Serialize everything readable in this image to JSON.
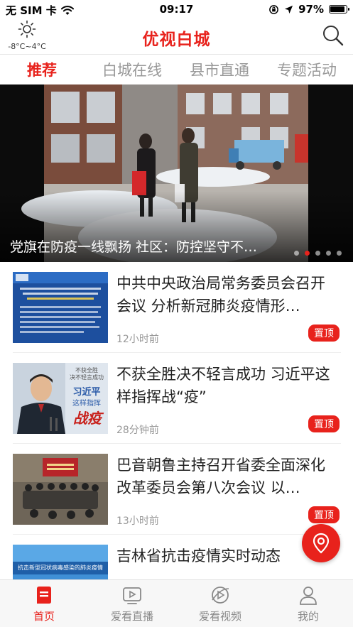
{
  "status_bar": {
    "carrier": "无 SIM 卡",
    "time": "09:17",
    "battery": "97%",
    "battery_level": 0.97
  },
  "header": {
    "title": "优视白城",
    "weather_temp": "-8°C~4°C",
    "weather_icon": "sun-icon",
    "search_icon": "search-icon"
  },
  "tabs": [
    {
      "label": "推荐",
      "active": true
    },
    {
      "label": "白城在线",
      "active": false
    },
    {
      "label": "县市直通",
      "active": false
    },
    {
      "label": "专题活动",
      "active": false
    }
  ],
  "banner": {
    "caption": "党旗在防疫一线飘扬 社区：防控坚守不…",
    "slide_count": 5,
    "active_slide": 2
  },
  "news": [
    {
      "title": "中共中央政治局常务委员会召开会议 分析新冠肺炎疫情形…",
      "time": "12小时前",
      "badge": "置顶"
    },
    {
      "title": "不获全胜决不轻言成功 习近平这样指挥战“疫”",
      "time": "28分钟前",
      "badge": "置顶"
    },
    {
      "title": "巴音朝鲁主持召开省委全面深化改革委员会第八次会议  以…",
      "time": "13小时前",
      "badge": "置顶"
    },
    {
      "title": "吉林省抗击疫情实时动态",
      "time": "",
      "badge": ""
    }
  ],
  "thumb_text": {
    "t2_line1": "不获全胜",
    "t2_line2": "决不轻言成功",
    "t2_name": "习近平",
    "t2_sub": "这样指挥",
    "t2_big": "战疫",
    "t4_text": "抗击新型冠状病毒感染的肺炎疫情"
  },
  "bottom_nav": [
    {
      "label": "首页",
      "icon": "home-icon",
      "active": true
    },
    {
      "label": "爱看直播",
      "icon": "live-icon",
      "active": false
    },
    {
      "label": "爱看视频",
      "icon": "video-icon",
      "active": false
    },
    {
      "label": "我的",
      "icon": "profile-icon",
      "active": false
    }
  ],
  "colors": {
    "accent": "#e8221c",
    "inactive_text": "#999999"
  }
}
